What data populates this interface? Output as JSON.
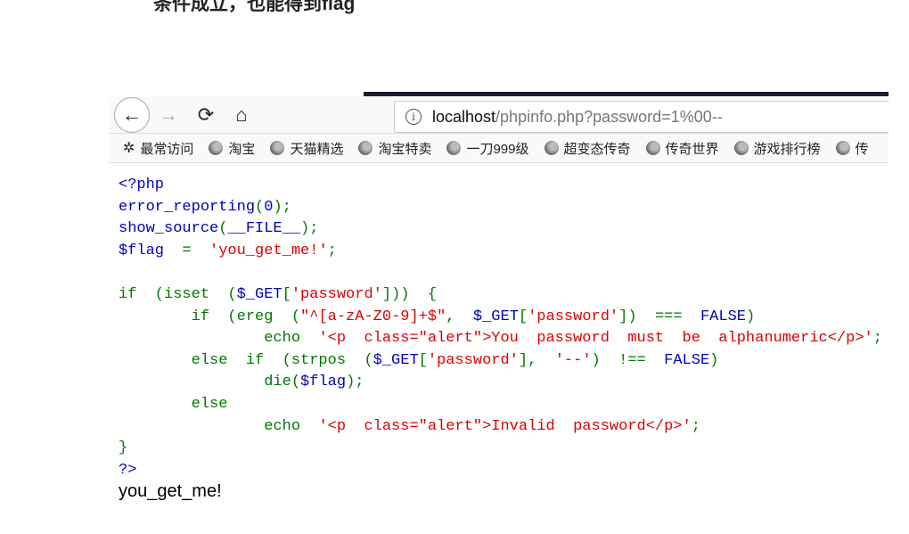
{
  "heading": "条件成立，也能得到flag",
  "browser": {
    "url_host": "localhost",
    "url_path": "/phpinfo.php?password=1%00--",
    "bookmarks": [
      {
        "label": "最常访问",
        "icon": "gear-icon"
      },
      {
        "label": "淘宝",
        "icon": "globe-icon"
      },
      {
        "label": "天猫精选",
        "icon": "globe-icon"
      },
      {
        "label": "淘宝特卖",
        "icon": "globe-icon"
      },
      {
        "label": "一刀999级",
        "icon": "globe-icon"
      },
      {
        "label": "超变态传奇",
        "icon": "globe-icon"
      },
      {
        "label": "传奇世界",
        "icon": "globe-icon"
      },
      {
        "label": "游戏排行榜",
        "icon": "globe-icon"
      },
      {
        "label": "传",
        "icon": "globe-icon"
      }
    ]
  },
  "colors": {
    "keyword": "#007700",
    "default": "#0000BB",
    "string": "#DD0000"
  },
  "code_lines": [
    [
      [
        "d",
        "<?php"
      ]
    ],
    [
      [
        "d",
        "error_reporting"
      ],
      [
        "k",
        "("
      ],
      [
        "d",
        "0"
      ],
      [
        "k",
        ");"
      ]
    ],
    [
      [
        "d",
        "show_source"
      ],
      [
        "k",
        "("
      ],
      [
        "d",
        "__FILE__"
      ],
      [
        "k",
        ");"
      ]
    ],
    [
      [
        "d",
        "$flag"
      ],
      [
        "k",
        "  =  "
      ],
      [
        "s",
        "'you_get_me!'"
      ],
      [
        "k",
        ";"
      ]
    ],
    [],
    [
      [
        "k",
        "if  (isset  ("
      ],
      [
        "d",
        "$_GET"
      ],
      [
        "k",
        "["
      ],
      [
        "s",
        "'password'"
      ],
      [
        "k",
        "]))  {"
      ]
    ],
    [
      [
        "k",
        "        if  (ereg  ("
      ],
      [
        "s",
        "\"^[a-zA-Z0-9]+$\""
      ],
      [
        "k",
        ",  "
      ],
      [
        "d",
        "$_GET"
      ],
      [
        "k",
        "["
      ],
      [
        "s",
        "'password'"
      ],
      [
        "k",
        "])  ===  "
      ],
      [
        "d",
        "FALSE"
      ],
      [
        "k",
        ")"
      ]
    ],
    [
      [
        "k",
        "                echo  "
      ],
      [
        "s",
        "'<p  class=\"alert\">You  password  must  be  alphanumeric</p>'"
      ],
      [
        "k",
        ";"
      ]
    ],
    [
      [
        "k",
        "        else  if  (strpos  ("
      ],
      [
        "d",
        "$_GET"
      ],
      [
        "k",
        "["
      ],
      [
        "s",
        "'password'"
      ],
      [
        "k",
        "],  "
      ],
      [
        "s",
        "'--'"
      ],
      [
        "k",
        ")  !==  "
      ],
      [
        "d",
        "FALSE"
      ],
      [
        "k",
        ")"
      ]
    ],
    [
      [
        "k",
        "                die("
      ],
      [
        "d",
        "$flag"
      ],
      [
        "k",
        ");"
      ]
    ],
    [
      [
        "k",
        "        else"
      ]
    ],
    [
      [
        "k",
        "                echo  "
      ],
      [
        "s",
        "'<p  class=\"alert\">Invalid  password</p>'"
      ],
      [
        "k",
        ";"
      ]
    ],
    [
      [
        "k",
        "}"
      ]
    ],
    [
      [
        "d",
        "?>"
      ]
    ]
  ],
  "output": "you_get_me!"
}
